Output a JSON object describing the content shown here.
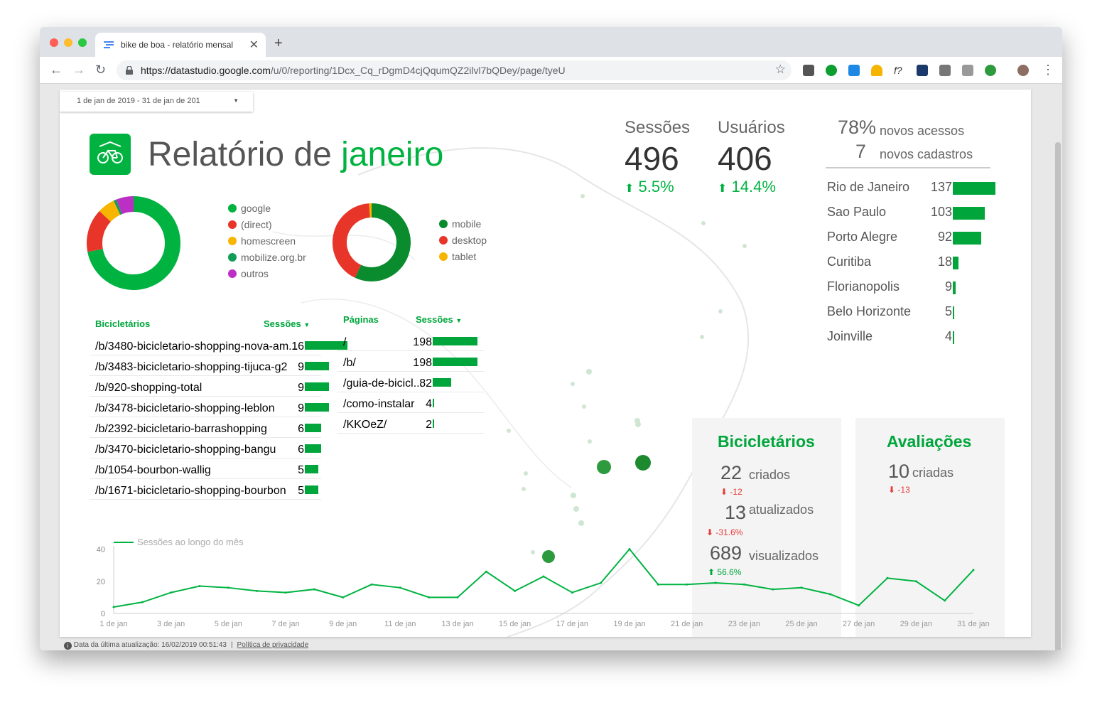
{
  "browser": {
    "tab_title": "bike de boa - relatório mensal",
    "url_host": "https://datastudio.google.com",
    "url_path": "/u/0/reporting/1Dcx_Cq_rDgmD4cjQqumQZ2ilvl7bQDey/page/tyeU"
  },
  "report": {
    "date_range": "1 de jan de 2019 - 31 de jan de 201",
    "title_prefix": "Relatório de",
    "title_month": "janeiro",
    "kpis": {
      "sessions_label": "Sessões",
      "sessions_value": "496",
      "sessions_delta": "5.5%",
      "users_label": "Usuários",
      "users_value": "406",
      "users_delta": "14.4%",
      "new_access_pct": "78%",
      "new_access_label": "novos acessos",
      "new_signups_value": "7",
      "new_signups_label": "novos cadastros"
    },
    "source_legend": [
      {
        "label": "google",
        "color": "#00b341",
        "value": 72
      },
      {
        "label": "(direct)",
        "color": "#e8352a",
        "value": 15
      },
      {
        "label": "homescreen",
        "color": "#f8b500",
        "value": 6
      },
      {
        "label": "mobilize.org.br",
        "color": "#0f9d58",
        "value": 1
      },
      {
        "label": "outros",
        "color": "#bb2fc4",
        "value": 6
      }
    ],
    "device_legend": [
      {
        "label": "mobile",
        "color": "#0a8c2e",
        "value": 57
      },
      {
        "label": "desktop",
        "color": "#e8352a",
        "value": 42
      },
      {
        "label": "tablet",
        "color": "#f8b500",
        "value": 1
      }
    ],
    "bike_table": {
      "col1": "Bicicletários",
      "col2": "Sessões",
      "rows": [
        {
          "label": "/b/3480-bicicletario-shopping-nova-am...",
          "value": 16
        },
        {
          "label": "/b/3483-bicicletario-shopping-tijuca-g2",
          "value": 9
        },
        {
          "label": "/b/920-shopping-total",
          "value": 9
        },
        {
          "label": "/b/3478-bicicletario-shopping-leblon",
          "value": 9
        },
        {
          "label": "/b/2392-bicicletario-barrashopping",
          "value": 6
        },
        {
          "label": "/b/3470-bicicletario-shopping-bangu",
          "value": 6
        },
        {
          "label": "/b/1054-bourbon-wallig",
          "value": 5
        },
        {
          "label": "/b/1671-bicicletario-shopping-bourbon",
          "value": 5
        }
      ]
    },
    "pages_table": {
      "col1": "Páginas",
      "col2": "Sessões",
      "rows": [
        {
          "label": "/",
          "value": 198
        },
        {
          "label": "/b/",
          "value": 198
        },
        {
          "label": "/guia-de-bicicl...",
          "value": 82
        },
        {
          "label": "/como-instalar",
          "value": 4
        },
        {
          "label": "/KKOeZ/",
          "value": 2
        }
      ]
    },
    "cities": [
      {
        "name": "Rio de Janeiro",
        "value": 137
      },
      {
        "name": "Sao Paulo",
        "value": 103
      },
      {
        "name": "Porto Alegre",
        "value": 92
      },
      {
        "name": "Curitiba",
        "value": 18
      },
      {
        "name": "Florianopolis",
        "value": 9
      },
      {
        "name": "Belo Horizonte",
        "value": 5
      },
      {
        "name": "Joinville",
        "value": 4
      }
    ],
    "bicicletarios_panel": {
      "title": "Bicicletários",
      "created_value": "22",
      "created_label": "criados",
      "created_delta": "-12",
      "updated_value": "13",
      "updated_label": "atualizados",
      "updated_delta": "-31.6%",
      "viewed_value": "689",
      "viewed_label": "visualizados",
      "viewed_delta": "56.6%"
    },
    "avaliacoes_panel": {
      "title": "Avaliações",
      "created_value": "10",
      "created_label": "criadas",
      "created_delta": "-13"
    },
    "footer": {
      "updated": "Data da última atualização: 16/02/2019 00:51:43",
      "privacy": "Política de privacidade"
    }
  },
  "chart_data": {
    "type": "line",
    "title": "",
    "legend": [
      "Sessões ao longo do mês"
    ],
    "x": [
      "1 de jan",
      "2 de jan",
      "3 de jan",
      "4 de jan",
      "5 de jan",
      "6 de jan",
      "7 de jan",
      "8 de jan",
      "9 de jan",
      "10 de jan",
      "11 de jan",
      "12 de jan",
      "13 de jan",
      "14 de jan",
      "15 de jan",
      "16 de jan",
      "17 de jan",
      "18 de jan",
      "19 de jan",
      "20 de jan",
      "21 de jan",
      "22 de jan",
      "23 de jan",
      "24 de jan",
      "25 de jan",
      "26 de jan",
      "27 de jan",
      "28 de jan",
      "29 de jan",
      "30 de jan",
      "31 de jan"
    ],
    "tick_labels": [
      "1 de jan",
      "3 de jan",
      "5 de jan",
      "7 de jan",
      "9 de jan",
      "11 de jan",
      "13 de jan",
      "15 de jan",
      "17 de jan",
      "19 de jan",
      "21 de jan",
      "23 de jan",
      "25 de jan",
      "27 de jan",
      "29 de jan",
      "31 de jan"
    ],
    "series": [
      {
        "name": "Sessões ao longo do mês",
        "values": [
          4,
          7,
          13,
          17,
          16,
          14,
          13,
          15,
          10,
          18,
          16,
          10,
          10,
          26,
          14,
          23,
          13,
          19,
          40,
          18,
          18,
          19,
          18,
          15,
          16,
          12,
          5,
          22,
          20,
          8,
          27
        ]
      }
    ],
    "yticks": [
      0,
      20,
      40
    ],
    "ylim": [
      0,
      42
    ],
    "line_color": "#00b341"
  }
}
